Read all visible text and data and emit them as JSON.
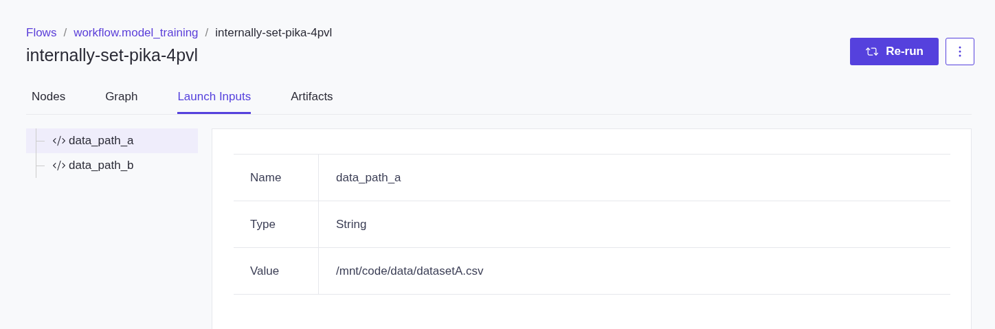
{
  "breadcrumb": [
    {
      "label": "Flows",
      "kind": "link"
    },
    {
      "label": "workflow.model_training",
      "kind": "link"
    },
    {
      "label": "internally-set-pika-4pvl",
      "kind": "current"
    }
  ],
  "breadcrumb_separator": "/",
  "title": "internally-set-pika-4pvl",
  "actions": {
    "rerun": "Re-run"
  },
  "tabs": [
    {
      "label": "Nodes",
      "selected": false
    },
    {
      "label": "Graph",
      "selected": false
    },
    {
      "label": "Launch Inputs",
      "selected": true
    },
    {
      "label": "Artifacts",
      "selected": false
    }
  ],
  "inputs": [
    {
      "label": "data_path_a",
      "selected": true
    },
    {
      "label": "data_path_b",
      "selected": false
    }
  ],
  "details": [
    {
      "field": "Name",
      "value": "data_path_a"
    },
    {
      "field": "Type",
      "value": "String"
    },
    {
      "field": "Value",
      "value": "/mnt/code/data/datasetA.csv"
    }
  ]
}
